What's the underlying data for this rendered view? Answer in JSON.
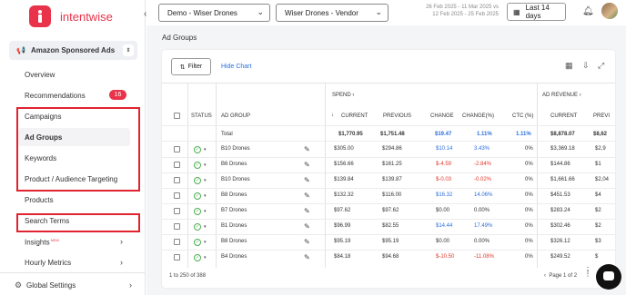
{
  "brand": {
    "name": "intentwise"
  },
  "sidebar": {
    "product": "Amazon Sponsored Ads",
    "items": [
      {
        "label": "Overview"
      },
      {
        "label": "Recommendations",
        "badge": "16"
      },
      {
        "label": "Campaigns"
      },
      {
        "label": "Ad Groups"
      },
      {
        "label": "Keywords"
      },
      {
        "label": "Product / Audience Targeting"
      },
      {
        "label": "Products"
      },
      {
        "label": "Search Terms"
      },
      {
        "label": "Insights",
        "tag": "NEW"
      },
      {
        "label": "Hourly Metrics"
      }
    ],
    "footer": "Global Settings"
  },
  "topbar": {
    "account": "Demo - Wiser Drones",
    "profile": "Wiser Drones - Vendor",
    "date_line1": "26 Feb 2025 - 11 Mar 2025 vs",
    "date_line2": "12 Feb 2025 - 25 Feb 2025",
    "range_button": "Last 14 days"
  },
  "page": {
    "title": "Ad Groups",
    "filter": "Filter",
    "hide_chart": "Hide Chart"
  },
  "table": {
    "groups": {
      "spend": "SPEND",
      "ad_revenue": "AD REVENUE"
    },
    "headers": {
      "status": "STATUS",
      "ad_group": "AD GROUP",
      "current": "CURRENT",
      "previous": "PREVIOUS",
      "change": "CHANGE",
      "change_pct": "CHANGE(%)",
      "ctc": "CTC (%)",
      "rev_current": "CURRENT",
      "rev_previous": "PREVI"
    },
    "total": {
      "label": "Total",
      "current": "$1,770.95",
      "previous": "$1,751.48",
      "change": "$19.47",
      "change_pct": "1.11%",
      "ctc": "1.11%",
      "rev_current": "$8,878.07",
      "rev_previous": "$8,62"
    },
    "rows": [
      {
        "name": "B10 Drones",
        "current": "$305.00",
        "previous": "$294.86",
        "change": "$10.14",
        "change_pct": "3.43%",
        "ctc": "0%",
        "rev_current": "$3,369.18",
        "rev_previous": "$2,9",
        "sign": "pos"
      },
      {
        "name": "B6 Drones",
        "current": "$156.66",
        "previous": "$161.25",
        "change": "$-4.59",
        "change_pct": "-2.84%",
        "ctc": "0%",
        "rev_current": "$144.86",
        "rev_previous": "$1",
        "sign": "neg"
      },
      {
        "name": "B10 Drones",
        "current": "$139.84",
        "previous": "$139.87",
        "change": "$-0.03",
        "change_pct": "-0.02%",
        "ctc": "0%",
        "rev_current": "$1,661.66",
        "rev_previous": "$2,04",
        "sign": "neg"
      },
      {
        "name": "B8 Drones",
        "current": "$132.32",
        "previous": "$116.00",
        "change": "$16.32",
        "change_pct": "14.06%",
        "ctc": "0%",
        "rev_current": "$451.53",
        "rev_previous": "$4",
        "sign": "pos"
      },
      {
        "name": "B7 Drones",
        "current": "$97.62",
        "previous": "$97.62",
        "change": "$0.00",
        "change_pct": "0.00%",
        "ctc": "0%",
        "rev_current": "$283.24",
        "rev_previous": "$2",
        "sign": "zero"
      },
      {
        "name": "B1 Drones",
        "current": "$96.99",
        "previous": "$82.55",
        "change": "$14.44",
        "change_pct": "17.49%",
        "ctc": "0%",
        "rev_current": "$302.46",
        "rev_previous": "$2",
        "sign": "pos"
      },
      {
        "name": "B8 Drones",
        "current": "$95.19",
        "previous": "$95.19",
        "change": "$0.00",
        "change_pct": "0.00%",
        "ctc": "0%",
        "rev_current": "$326.12",
        "rev_previous": "$3",
        "sign": "zero"
      },
      {
        "name": "B4 Drones",
        "current": "$84.18",
        "previous": "$94.68",
        "change": "$-10.50",
        "change_pct": "-11.08%",
        "ctc": "0%",
        "rev_current": "$249.52",
        "rev_previous": "$",
        "sign": "neg"
      }
    ],
    "footer_left": "1 to 250 of 388",
    "footer_right": "Page 1 of 2"
  }
}
